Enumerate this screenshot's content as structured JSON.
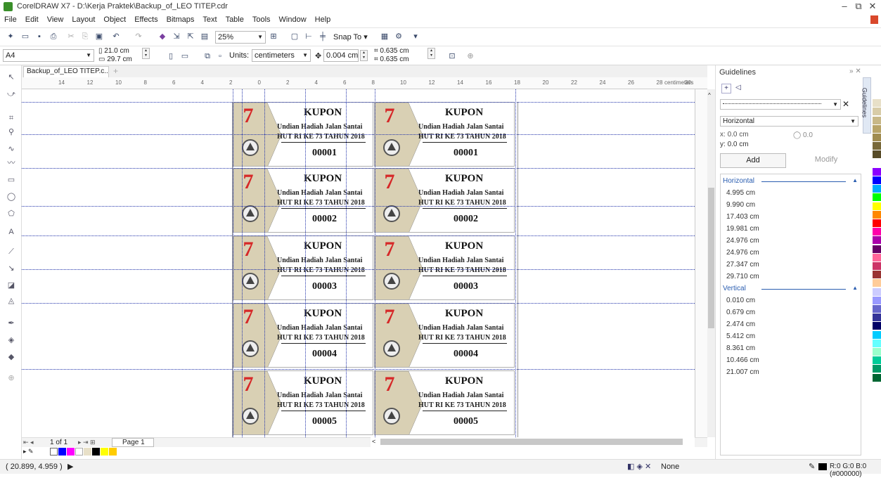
{
  "window": {
    "title": "CorelDRAW X7 - D:\\Kerja Praktek\\Backup_of_LEO TITEP.cdr"
  },
  "menu": [
    "File",
    "Edit",
    "View",
    "Layout",
    "Object",
    "Effects",
    "Bitmaps",
    "Text",
    "Table",
    "Tools",
    "Window",
    "Help"
  ],
  "toolbar": {
    "zoom": "25%",
    "snap_label": "Snap To"
  },
  "property_bar": {
    "page_size": "A4",
    "width": "21.0 cm",
    "height": "29.7 cm",
    "units_label": "Units:",
    "units_value": "centimeters",
    "nudge": "0.004 cm",
    "dup_x": "0.635 cm",
    "dup_y": "0.635 cm"
  },
  "document_tab": "Backup_of_LEO TITEP.c...",
  "ruler": {
    "h_ticks": [
      "14",
      "12",
      "10",
      "8",
      "6",
      "4",
      "2",
      "0",
      "2",
      "4",
      "6",
      "8",
      "10",
      "12",
      "14",
      "16",
      "18",
      "20",
      "22",
      "24",
      "26",
      "28",
      "30"
    ],
    "unit": "centimeters"
  },
  "coupon": {
    "title": "KUPON",
    "line1": "Undian Hadiah Jalan Santai",
    "line2": "HUT RI KE 73 TAHUN 2018"
  },
  "coupons": [
    "00001",
    "00002",
    "00003",
    "00004",
    "00005"
  ],
  "page_nav": {
    "page_count": "1 of 1",
    "page_label": "Page 1"
  },
  "status": {
    "coords": "( 20.899, 4.959 )",
    "fill": "None",
    "outline": "R:0 G:0 B:0 (#000000)"
  },
  "docker": {
    "title": "Guidelines",
    "orientation": "Horizontal",
    "x_label": "x:",
    "x_value": "0.0 cm",
    "y_label": "y:",
    "y_value": "0.0 cm",
    "angle": "0.0",
    "add_label": "Add",
    "modify_label": "Modify",
    "tab_label": "Guidelines",
    "horizontal_header": "Horizontal",
    "horizontal": [
      "4.995 cm",
      "9.990 cm",
      "17.403 cm",
      "19.981 cm",
      "24.976 cm",
      "24.976 cm",
      "27.347 cm",
      "29.710 cm"
    ],
    "vertical_header": "Vertical",
    "vertical": [
      "0.010 cm",
      "0.679 cm",
      "2.474 cm",
      "5.412 cm",
      "8.361 cm",
      "10.466 cm",
      "21.007 cm"
    ]
  },
  "colors": {
    "palette": [
      "#ffffff",
      "#e8e0c8",
      "#d8cca8",
      "#c8b888",
      "#b8a468",
      "#a08c50",
      "#786838",
      "#584c28",
      "#ffffff",
      "#8b00ff",
      "#0000ff",
      "#00aaff",
      "#00ff00",
      "#ffff00",
      "#ff8800",
      "#ff0000",
      "#ff00aa",
      "#aa00aa",
      "#660066",
      "#ff6699",
      "#cc3366",
      "#993333",
      "#ffcc99",
      "#ccccff",
      "#9999ff",
      "#6666cc",
      "#333399",
      "#000066",
      "#00ccff",
      "#66ffff",
      "#99ffcc",
      "#00cc99",
      "#009966",
      "#006633"
    ]
  }
}
